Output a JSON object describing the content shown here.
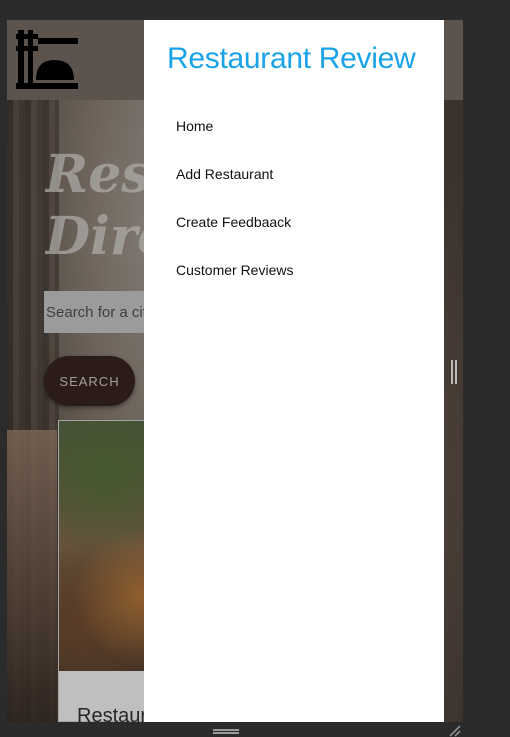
{
  "background_page": {
    "hero_title": "Restaurant\nDirectory",
    "search_placeholder": "Search for a city",
    "search_button": "SEARCH",
    "card_title": "Restaurant"
  },
  "drawer": {
    "title": "Restaurant Review",
    "title_color": "#1aa3e8",
    "items": [
      {
        "label": "Home"
      },
      {
        "label": "Add Restaurant"
      },
      {
        "label": "Create Feedbaack"
      },
      {
        "label": "Customer Reviews"
      }
    ]
  },
  "icons": {
    "logo": "restaurant-logo-icon",
    "resize": "resize-handle-icon",
    "corner": "corner-grip-icon"
  }
}
